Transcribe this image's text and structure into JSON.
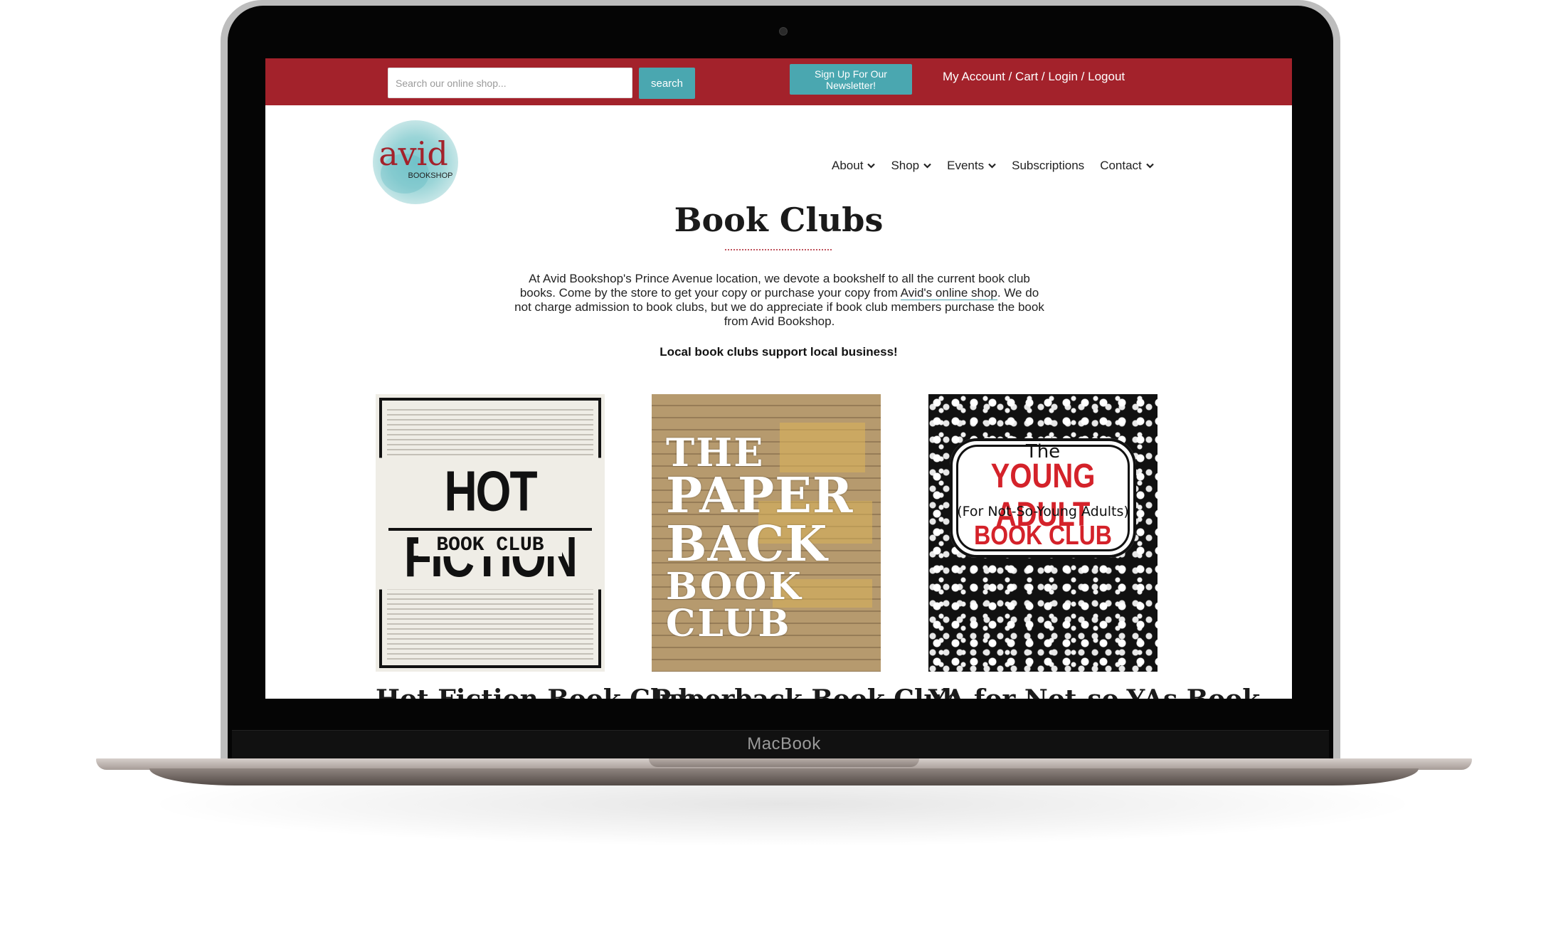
{
  "device": {
    "brand_label": "MacBook"
  },
  "topbar": {
    "search_placeholder": "Search our online shop...",
    "search_button": "search",
    "newsletter_button": "Sign Up For Our Newsletter!",
    "account_links": [
      "My Account",
      "Cart",
      "Login",
      "Logout"
    ],
    "separator": " / "
  },
  "logo": {
    "word": "avid",
    "sub": "BOOKSHOP"
  },
  "nav": {
    "items": [
      {
        "label": "About",
        "has_dropdown": true
      },
      {
        "label": "Shop",
        "has_dropdown": true
      },
      {
        "label": "Events",
        "has_dropdown": true
      },
      {
        "label": "Subscriptions",
        "has_dropdown": false
      },
      {
        "label": "Contact",
        "has_dropdown": true
      }
    ]
  },
  "page": {
    "title": "Book Clubs",
    "intro_before_link": "At Avid Bookshop's Prince Avenue location, we devote a bookshelf to all the current book club books. Come by the store to get your copy or purchase your copy from ",
    "intro_link": "Avid's online shop",
    "intro_after_link": ". We do not charge admission to book clubs, but we do appreciate if book club members purchase the book from Avid Bookshop.",
    "tagline": "Local book clubs support local business!"
  },
  "clubs": [
    {
      "title": "Hot Fiction Book Club",
      "cover": {
        "line1": "HOT FICTION",
        "line2": "BOOK CLUB"
      }
    },
    {
      "title": "Paperback Book Club",
      "cover": {
        "line1": "THE",
        "line2": "PAPER",
        "line3": "BACK",
        "line4": "BOOK",
        "line5": "CLUB"
      }
    },
    {
      "title": "YA for Not-so-YAs Book",
      "cover": {
        "line1": "The",
        "line2": "YOUNG ADULT",
        "line3": "(For Not-So-Young Adults)",
        "line4": "BOOK CLUB"
      }
    }
  ],
  "colors": {
    "topbar_red": "#a3222b",
    "teal_button": "#4aa7b0",
    "ya_red": "#d4222a"
  }
}
